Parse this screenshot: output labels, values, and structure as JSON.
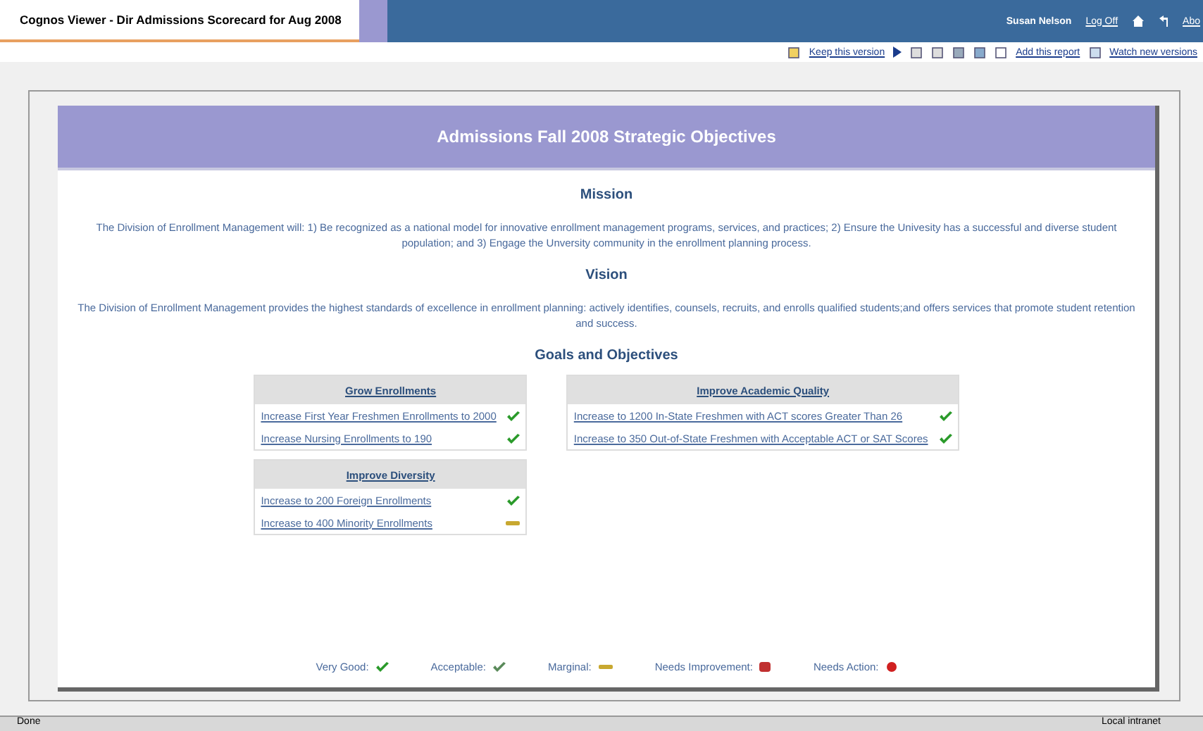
{
  "window": {
    "title": "Cognos Viewer - Dir Admissions Scorecard for Aug 2008"
  },
  "user_bar": {
    "user": "Susan Nelson",
    "log_off": "Log Off",
    "cut_link": "Abo"
  },
  "toolbar": {
    "keep_version": "Keep this version",
    "add_report": "Add this report",
    "watch_versions": "Watch new versions"
  },
  "report": {
    "title": "Admissions Fall 2008 Strategic Objectives",
    "sections": [
      {
        "heading": "Mission",
        "text": "The Division of Enrollment Management will: 1) Be recognized as a national model for innovative enrollment management programs, services, and practices; 2) Ensure the Univesity has a successful and diverse student population; and 3) Engage the Unversity community in the enrollment planning process."
      },
      {
        "heading": "Vision",
        "text": "The Division of Enrollment Management provides the highest standards of excellence in enrollment planning: actively identifies, counsels, recruits, and enrolls qualified students;and offers services that promote student retention and success."
      }
    ],
    "goals_heading": "Goals and Objectives",
    "columns": [
      [
        {
          "title": "Grow Enrollments",
          "objectives": [
            {
              "text": "Increase First Year Freshmen Enrollments to 2000",
              "kind": "very-good"
            },
            {
              "text": "Increase Nursing Enrollments to 190",
              "kind": "very-good"
            }
          ]
        },
        {
          "title": "Improve Diversity",
          "objectives": [
            {
              "text": "Increase to 200 Foreign Enrollments",
              "kind": "very-good"
            },
            {
              "text": "Increase to 400 Minority Enrollments",
              "kind": "marginal"
            }
          ]
        }
      ],
      [
        {
          "title": "Improve Academic Quality",
          "objectives": [
            {
              "text": "Increase to 1200 In-State Freshmen with ACT scores Greater Than 26",
              "kind": "very-good"
            },
            {
              "text": "Increase to 350 Out-of-State Freshmen with Acceptable ACT or SAT Scores",
              "kind": "very-good"
            }
          ]
        }
      ]
    ],
    "legend": [
      {
        "label": "Very Good:",
        "kind": "very-good"
      },
      {
        "label": "Acceptable:",
        "kind": "acceptable"
      },
      {
        "label": "Marginal:",
        "kind": "marginal"
      },
      {
        "label": "Needs Improvement:",
        "kind": "needs-improvement"
      },
      {
        "label": "Needs Action:",
        "kind": "needs-action"
      }
    ]
  },
  "status_bar": {
    "text": "Done",
    "zone": "Local intranet"
  }
}
